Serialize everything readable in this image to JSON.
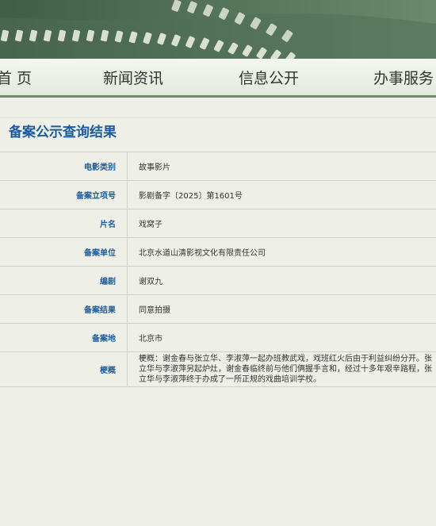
{
  "nav": {
    "items": [
      {
        "label": "首 页"
      },
      {
        "label": "新闻资讯"
      },
      {
        "label": "信息公开"
      },
      {
        "label": "办事服务"
      }
    ]
  },
  "page": {
    "title": "备案公示查询结果"
  },
  "record": {
    "rows": [
      {
        "label": "电影类别",
        "value": "故事影片"
      },
      {
        "label": "备案立项号",
        "value": "影剧备字〔2025〕第1601号"
      },
      {
        "label": "片名",
        "value": "戏窝子"
      },
      {
        "label": "备案单位",
        "value": "北京水道山清影视文化有限责任公司"
      },
      {
        "label": "编剧",
        "value": "谢双九"
      },
      {
        "label": "备案结果",
        "value": "同意拍摄"
      },
      {
        "label": "备案地",
        "value": "北京市"
      },
      {
        "label": "梗概",
        "value": "梗概：谢金春与张立华、李淑萍一起办班教武戏，戏班红火后由于利益纠纷分开。张立华与李淑萍另起炉灶，谢金春临终前与他们俩握手言和，经过十多年艰辛路程，张立华与李淑萍终于办成了一所正规的戏曲培训学校。"
      }
    ]
  }
}
